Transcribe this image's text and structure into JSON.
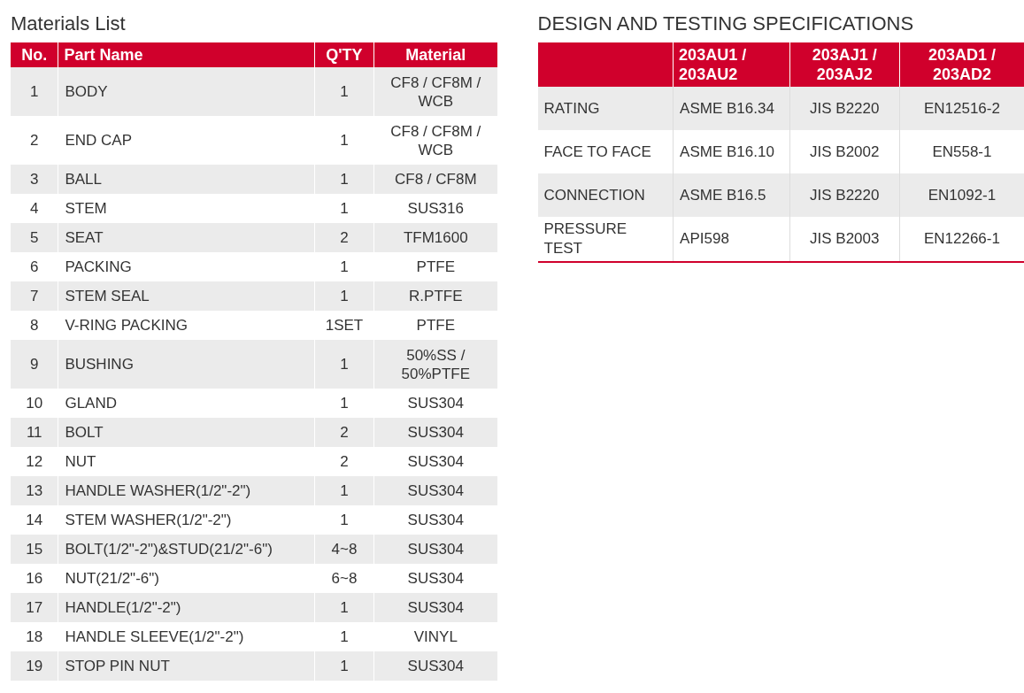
{
  "materials": {
    "title": "Materials List",
    "columns": [
      "No.",
      "Part Name",
      "Q'TY",
      "Material"
    ],
    "rows": [
      [
        "1",
        "BODY",
        "1",
        "CF8 / CF8M / WCB"
      ],
      [
        "2",
        "END CAP",
        "1",
        "CF8 / CF8M / WCB"
      ],
      [
        "3",
        "BALL",
        "1",
        "CF8 / CF8M"
      ],
      [
        "4",
        "STEM",
        "1",
        "SUS316"
      ],
      [
        "5",
        "SEAT",
        "2",
        "TFM1600"
      ],
      [
        "6",
        "PACKING",
        "1",
        "PTFE"
      ],
      [
        "7",
        "STEM SEAL",
        "1",
        "R.PTFE"
      ],
      [
        "8",
        "V-RING PACKING",
        "1SET",
        "PTFE"
      ],
      [
        "9",
        "BUSHING",
        "1",
        "50%SS / 50%PTFE"
      ],
      [
        "10",
        "GLAND",
        "1",
        "SUS304"
      ],
      [
        "11",
        "BOLT",
        "2",
        "SUS304"
      ],
      [
        "12",
        "NUT",
        "2",
        "SUS304"
      ],
      [
        "13",
        "HANDLE WASHER(1/2\"-2\")",
        "1",
        "SUS304"
      ],
      [
        "14",
        "STEM WASHER(1/2\"-2\")",
        "1",
        "SUS304"
      ],
      [
        "15",
        "BOLT(1/2\"-2\")&STUD(21/2\"-6\")",
        "4~8",
        "SUS304"
      ],
      [
        "16",
        "NUT(21/2\"-6\")",
        "6~8",
        "SUS304"
      ],
      [
        "17",
        "HANDLE(1/2\"-2\")",
        "1",
        "SUS304"
      ],
      [
        "18",
        "HANDLE SLEEVE(1/2\"-2\")",
        "1",
        "VINYL"
      ],
      [
        "19",
        "STOP PIN NUT",
        "1",
        "SUS304"
      ]
    ]
  },
  "specs": {
    "title": "DESIGN AND TESTING SPECIFICATIONS",
    "columns": [
      "203AU1 / 203AU2",
      "203AJ1 / 203AJ2",
      "203AD1 / 203AD2"
    ],
    "rows": [
      {
        "label": "RATING",
        "values": [
          "ASME B16.34",
          "JIS B2220",
          "EN12516-2"
        ]
      },
      {
        "label": "FACE TO FACE",
        "values": [
          "ASME B16.10",
          "JIS B2002",
          "EN558-1"
        ]
      },
      {
        "label": "CONNECTION",
        "values": [
          "ASME B16.5",
          "JIS B2220",
          "EN1092-1"
        ]
      },
      {
        "label": "PRESSURE TEST",
        "values": [
          "API598",
          "JIS B2003",
          "EN12266-1"
        ]
      }
    ]
  }
}
